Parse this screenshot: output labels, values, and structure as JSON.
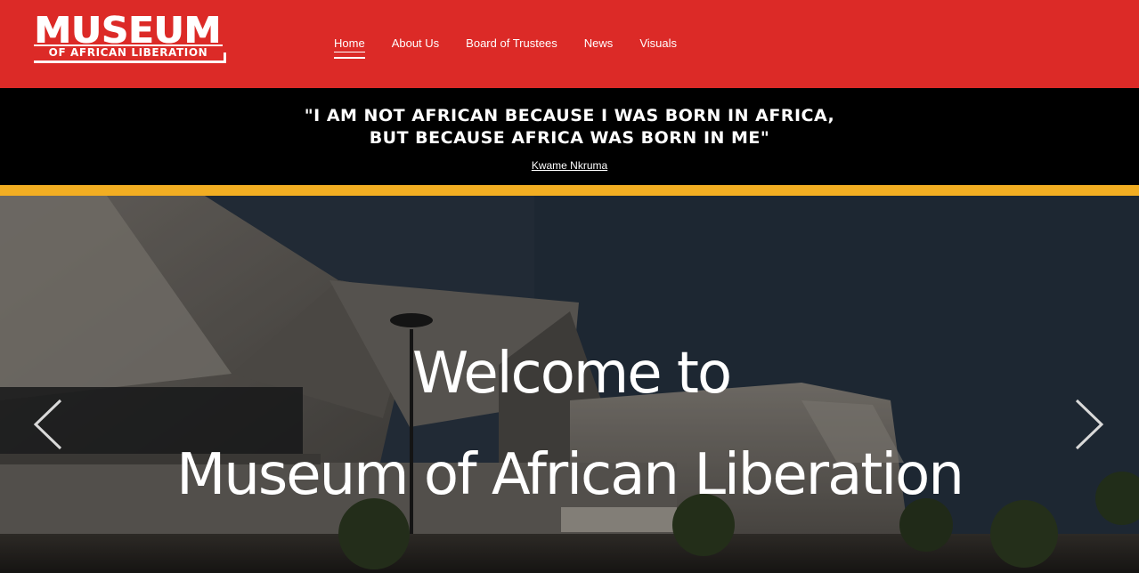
{
  "header": {
    "logo": {
      "title": "MUSEUM",
      "subtitle": "OF AFRICAN LIBERATION"
    },
    "nav": [
      {
        "label": "Home",
        "active": true
      },
      {
        "label": "About Us",
        "active": false
      },
      {
        "label": "Board of Trustees",
        "active": false
      },
      {
        "label": "News",
        "active": false
      },
      {
        "label": "Visuals",
        "active": false
      }
    ],
    "brand_color": "#dc2a27"
  },
  "quote": {
    "line1": "\"I am not African because I was born in Africa,",
    "line2": "but because Africa was born in me\"",
    "author": "Kwame Nkruma"
  },
  "accent_stripe_color": "#f2ae22",
  "hero": {
    "line1": "Welcome to",
    "line2": "Museum of African Liberation",
    "prev_icon": "chevron-left-icon",
    "next_icon": "chevron-right-icon"
  }
}
